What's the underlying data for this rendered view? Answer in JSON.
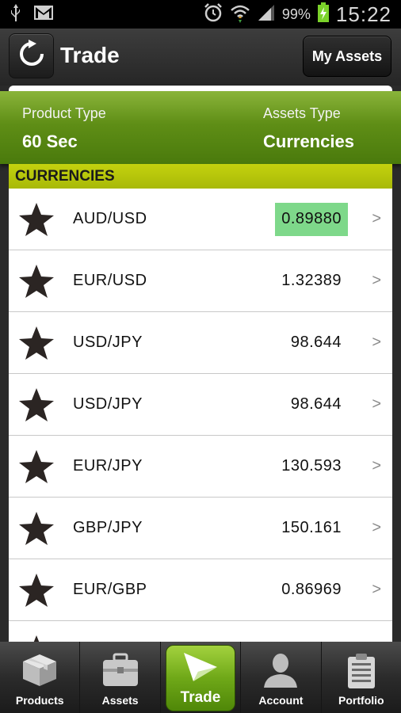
{
  "status_bar": {
    "battery_text": "99%",
    "time": "15:22",
    "icons": [
      "usb-icon",
      "gmail-icon",
      "alarm-icon",
      "wifi-icon",
      "signal-icon",
      "battery-charging-icon"
    ]
  },
  "header": {
    "title": "Trade",
    "my_assets_label": "My Assets"
  },
  "product_panel": {
    "product_type_label": "Product Type",
    "product_type_value": "60 Sec",
    "assets_type_label": "Assets Type",
    "assets_type_value": "Currencies"
  },
  "section": {
    "title": "CURRENCIES"
  },
  "assets": [
    {
      "name": "AUD/USD",
      "price": "0.89880",
      "highlight": true
    },
    {
      "name": "EUR/USD",
      "price": "1.32389",
      "highlight": false
    },
    {
      "name": "USD/JPY",
      "price": "98.644",
      "highlight": false
    },
    {
      "name": "USD/JPY",
      "price": "98.644",
      "highlight": false
    },
    {
      "name": "EUR/JPY",
      "price": "130.593",
      "highlight": false
    },
    {
      "name": "GBP/JPY",
      "price": "150.161",
      "highlight": false
    },
    {
      "name": "EUR/GBP",
      "price": "0.86969",
      "highlight": false
    }
  ],
  "chevron": ">",
  "bottom_nav": [
    {
      "label": "Products",
      "icon": "box-icon"
    },
    {
      "label": "Assets",
      "icon": "briefcase-icon"
    },
    {
      "label": "Trade",
      "icon": "paper-plane-icon",
      "active": true
    },
    {
      "label": "Account",
      "icon": "person-icon"
    },
    {
      "label": "Portfolio",
      "icon": "clipboard-icon"
    }
  ],
  "colors": {
    "accent_green": "#6fa818",
    "section_yellow_green": "#b8c80c",
    "price_highlight": "#7ed88a"
  }
}
